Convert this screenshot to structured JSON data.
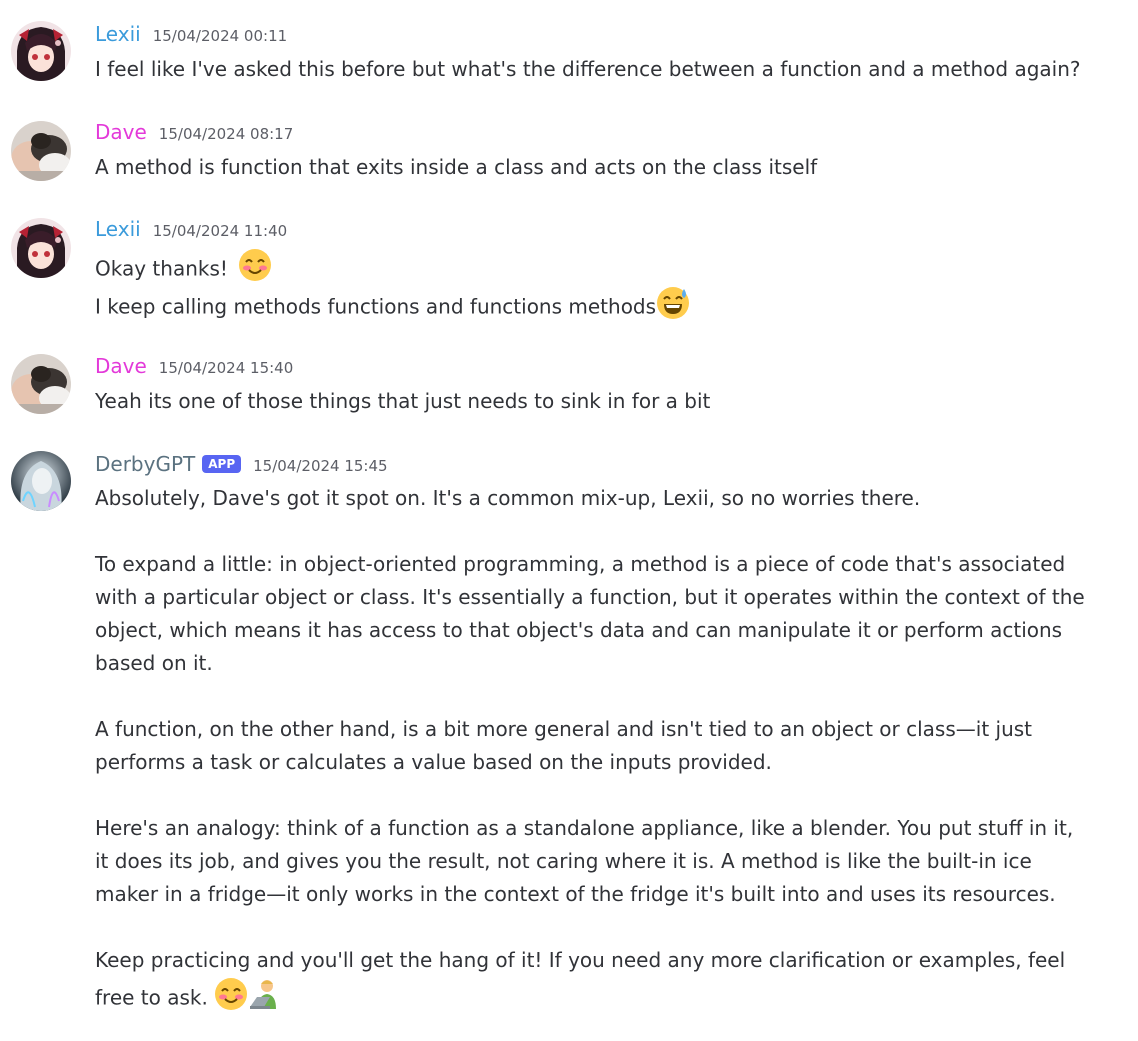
{
  "messages": [
    {
      "author": "Lexii",
      "author_color": "#3b9bdb",
      "timestamp": "15/04/2024 00:11",
      "lines": [
        "I feel like I've asked this before but what's the difference between a function and a method again?"
      ]
    },
    {
      "author": "Dave",
      "author_color": "#e339d9",
      "timestamp": "15/04/2024 08:17",
      "lines": [
        "A method is function that exits inside a class and acts on the class itself"
      ]
    },
    {
      "author": "Lexii",
      "author_color": "#3b9bdb",
      "timestamp": "15/04/2024 11:40",
      "lines": [
        "Okay thanks!",
        "I keep calling methods functions and functions methods"
      ],
      "emojis": [
        "smiling-face-with-blush-emoji",
        "grinning-face-with-sweat-emoji"
      ]
    },
    {
      "author": "Dave",
      "author_color": "#e339d9",
      "timestamp": "15/04/2024 15:40",
      "lines": [
        "Yeah its one of those things that just needs to sink in for a bit"
      ]
    },
    {
      "author": "DerbyGPT",
      "author_color": "#5b7280",
      "badge": "APP",
      "timestamp": "15/04/2024 15:45",
      "paragraphs": [
        "Absolutely, Dave's got it spot on. It's a common mix-up, Lexii, so no worries there.",
        "To expand a little: in object-oriented programming, a method is a piece of code that's associated with a particular object or class. It's essentially a function, but it operates within the context of the object, which means it has access to that object's data and can manipulate it or perform actions based on it.",
        "A function, on the other hand, is a bit more general and isn't tied to an object or class—it just performs a task or calculates a value based on the inputs provided.",
        "Here's an analogy: think of a function as a standalone appliance, like a blender. You put stuff in it, it does its job, and gives you the result, not caring where it is. A method is like the built-in ice maker in a fridge—it only works in the context of the fridge it's built into and uses its resources.",
        "Keep practicing and you'll get the hang of it! If you need any more clarification or examples, feel free to ask."
      ],
      "emojis": [
        "smiling-face-with-blush-emoji",
        "technologist-emoji"
      ]
    }
  ]
}
